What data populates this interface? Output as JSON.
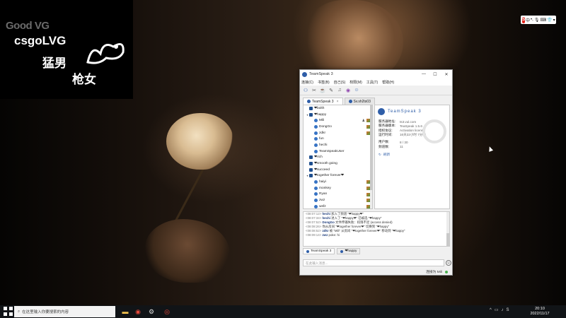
{
  "logo": {
    "top_text": "Good VG",
    "main_text": "csgoLVG",
    "cn_left": "猛男",
    "cn_right": "枪女"
  },
  "ime": {
    "brand": "S",
    "mode": "中"
  },
  "window": {
    "title": "TeamSpeak 3",
    "menu": [
      "连接(C)",
      "书签(B)",
      "自己(S)",
      "权限(M)",
      "工具(T)",
      "帮助(H)"
    ],
    "toolbar_icons": [
      "connect-icon",
      "disconnect-icon",
      "away-icon",
      "mute-mic-icon",
      "mute-speaker-icon",
      "subscribe-icon",
      "contacts-icon"
    ],
    "tabs": [
      {
        "label": "TeamSpeak 3"
      },
      {
        "label": "Sv.sh2ts03"
      }
    ],
    "tree": [
      {
        "label": "❤bolth",
        "type": "channel",
        "expanded": false,
        "indent": 1
      },
      {
        "label": "❤happy",
        "type": "channel",
        "expanded": true,
        "indent": 1
      },
      {
        "label": "Mili",
        "type": "user",
        "indent": 2,
        "flags": 2
      },
      {
        "label": "DongGo",
        "type": "user",
        "indent": 2,
        "flags": 1
      },
      {
        "label": "zdkr",
        "type": "user",
        "indent": 2,
        "flags": 1
      },
      {
        "label": "fun",
        "type": "user",
        "indent": 2,
        "flags": 0
      },
      {
        "label": "hechi",
        "type": "user",
        "indent": 2,
        "flags": 0
      },
      {
        "label": "TeamSpeakUser",
        "type": "user",
        "indent": 2,
        "flags": 0
      },
      {
        "label": "❤rich",
        "type": "channel",
        "expanded": false,
        "indent": 1
      },
      {
        "label": "❤smooth going",
        "type": "channel",
        "expanded": false,
        "indent": 1
      },
      {
        "label": "❤succeed",
        "type": "channel",
        "expanded": false,
        "indent": 1
      },
      {
        "label": "❤together forever❤",
        "type": "channel",
        "expanded": true,
        "indent": 1
      },
      {
        "label": "haiyi",
        "type": "user",
        "indent": 2,
        "flags": 1
      },
      {
        "label": "monkey",
        "type": "user",
        "indent": 2,
        "flags": 1
      },
      {
        "label": "Ryan",
        "type": "user",
        "indent": 2,
        "flags": 1
      },
      {
        "label": "zwz",
        "type": "user",
        "indent": 2,
        "flags": 1
      },
      {
        "label": "wsfz",
        "type": "user",
        "indent": 2,
        "flags": 1
      }
    ],
    "info": {
      "name": "TeamSpeak 3",
      "rows1": [
        {
          "k": "服务器地址:",
          "v": "ts3.vul.com"
        },
        {
          "k": "服务器版本:",
          "v": "TeaSpeak 1.5.6"
        },
        {
          "k": "授权协议:",
          "v": "Activation license"
        },
        {
          "k": "运行时间:",
          "v": "16天22小时 7分钟"
        }
      ],
      "rows2": [
        {
          "k": "用户数:",
          "v": "8 / 30"
        },
        {
          "k": "频道数:",
          "v": "11"
        }
      ],
      "refresh": "刷新"
    },
    "chat": [
      {
        "time": "<08:07:12>",
        "nick": "hechi",
        "msg": " 加入了频道 \"❤happy❤\""
      },
      {
        "time": "<08:07:34>",
        "nick": "hechi",
        "msg": " 进入了 \"❤happy❤\" 已被选 \"❤happy\""
      },
      {
        "time": "<08:07:52>",
        "nick": "DongGo",
        "msg": " 文件传输失败：权限不足 (access denied)"
      },
      {
        "time": "<08:08:26>",
        "nick": "",
        "msg": "你从房间 \"❤together forever❤\" 切换到 \"❤happy\""
      },
      {
        "time": "<08:08:52>",
        "nick": "zdkr",
        "msg": " 被 \"Mili\" 从房间 \"❤together forever❤\" 移动到 \"❤happy\""
      },
      {
        "time": "<08:09:14>",
        "nick": "zwz",
        "msg": " poke: hi"
      }
    ],
    "chat_tabs": [
      {
        "label": "TeamSpeak 3"
      },
      {
        "label": "❤happy"
      }
    ],
    "input_placeholder": "在此输入消息...",
    "status_text": "连接为 Mili"
  },
  "taskbar": {
    "search_placeholder": "在这里输入你要搜索的内容",
    "time": "20:10",
    "date": "2022/11/17"
  }
}
